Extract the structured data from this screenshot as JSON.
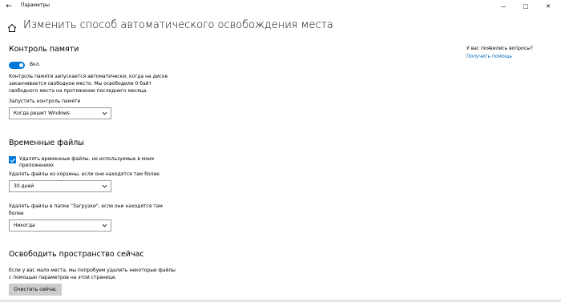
{
  "window": {
    "title": "Параметры",
    "back_glyph": "←",
    "minimize_glyph": "—",
    "maximize_glyph": "□",
    "close_glyph": "✕"
  },
  "header": {
    "title": "Изменить способ автоматического освобождения места",
    "icon": "home-icon"
  },
  "storage_sense": {
    "heading": "Контроль памяти",
    "toggle_state": "on",
    "toggle_label": "Вкл.",
    "description_lines": [
      "Контроль памяти запускается автоматически, когда на диске",
      "заканчивается свободное место. Мы освободили 0 байт",
      "свободного места на протяжении последнего месяца."
    ],
    "run_label": "Запустить контроль памяти",
    "run_value": "Когда решит Windows"
  },
  "temp_files": {
    "heading": "Временные файлы",
    "checkbox_checked": true,
    "checkbox_label": "Удалять временные файлы, не используемые в моих приложениях",
    "recycle_label": "Удалять файлы из корзины, если они находятся там более",
    "recycle_value": "30 дней",
    "downloads_label": "Удалять файлы в папке \"Загрузки\", если они находятся там более",
    "downloads_value": "Никогда"
  },
  "free_now": {
    "heading": "Освободить пространство сейчас",
    "description_lines": [
      "Если у вас мало места, мы попробуем удалить некоторые файлы",
      "с помощью параметров на этой странице."
    ],
    "button_label": "Очистить сейчас"
  },
  "help": {
    "question": "У вас появились вопросы?",
    "link": "Получить помощь"
  },
  "colors": {
    "accent": "#0078d7",
    "link": "#0067b8",
    "button_bg": "#cccccc"
  }
}
